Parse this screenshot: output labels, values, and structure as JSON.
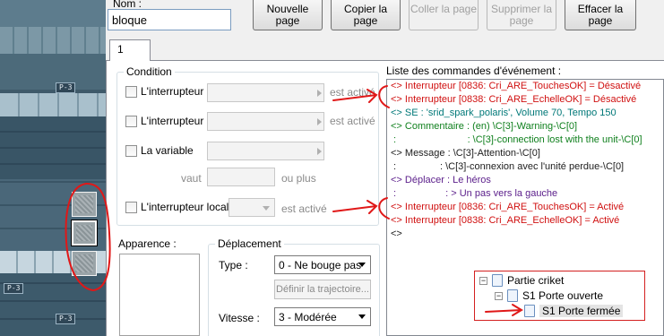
{
  "event": {
    "name_label": "Nom :",
    "name_value": "bloque"
  },
  "toolbar": {
    "new_page": "Nouvelle page",
    "copy_page": "Copier la page",
    "paste_page": "Coller la page",
    "delete_page": "Supprimer la page",
    "clear_page": "Effacer la page"
  },
  "tabs": {
    "page1": "1"
  },
  "condition": {
    "legend": "Condition",
    "switch1_label": "L'interrupteur",
    "switch1_status": "est activé",
    "switch2_label": "L'interrupteur",
    "switch2_status": "est activé",
    "variable_label": "La variable",
    "variable_value_label": "vaut",
    "variable_suffix": "ou plus",
    "local_switch_label": "L'interrupteur local",
    "local_switch_status": "est activé"
  },
  "appearance": {
    "label": "Apparence :"
  },
  "movement": {
    "legend": "Déplacement",
    "type_label": "Type :",
    "type_value": "0 - Ne bouge pas",
    "route_button": "Définir la trajectoire...",
    "speed_label": "Vitesse :",
    "speed_value": "3 - Modérée"
  },
  "commands": {
    "title": "Liste des commandes d'événement :",
    "lines": [
      {
        "text": "<> Interrupteur [0836: Cri_ARE_TouchesOK] = Désactivé",
        "color": "red"
      },
      {
        "text": "<> Interrupteur [0838: Cri_ARE_EchelleOK] = Désactivé",
        "color": "red"
      },
      {
        "text": "<> SE : 'srid_spark_polaris', Volume 70, Tempo 150",
        "color": "teal"
      },
      {
        "text": "<> Commentaire : (en) \\C[3]-Warning-\\C[0]",
        "color": "green"
      },
      {
        "text": " :                          : \\C[3]-connection lost with the unit-\\C[0]",
        "color": "green"
      },
      {
        "text": "<> Message : \\C[3]-Attention-\\C[0]",
        "color": "black"
      },
      {
        "text": " :                : \\C[3]-connexion avec l'unité perdue-\\C[0]",
        "color": "black"
      },
      {
        "text": "<> Déplacer : Le héros",
        "color": "purple"
      },
      {
        "text": " :                  : > Un pas vers la gauche",
        "color": "purple"
      },
      {
        "text": "<> Interrupteur [0836: Cri_ARE_TouchesOK] = Activé",
        "color": "red"
      },
      {
        "text": "<> Interrupteur [0838: Cri_ARE_EchelleOK] = Activé",
        "color": "red"
      },
      {
        "text": "<>",
        "color": "black"
      }
    ]
  },
  "tree": {
    "root": "Partie criket",
    "child": "S1 Porte ouverte",
    "grandchild": "S1 Porte fermée",
    "expand_symbol": "−"
  },
  "map": {
    "labels": [
      "P-3",
      "P-3",
      "P-3"
    ]
  },
  "colors": {
    "command_red": "#d01010",
    "command_teal": "#007878",
    "command_green": "#10801e",
    "command_purple": "#5a1d8a",
    "annotation_red": "#e01818"
  }
}
